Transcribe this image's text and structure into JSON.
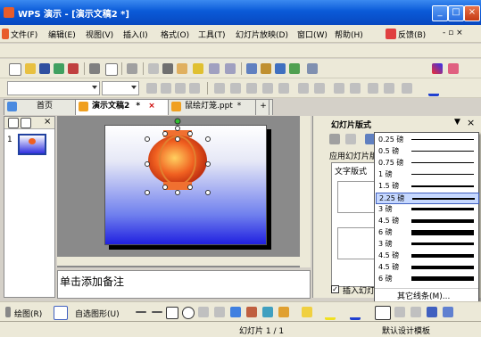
{
  "window": {
    "title": "WPS 演示 - [演示文稿2 *]",
    "min_label": "_",
    "max_label": "□",
    "close_label": "×"
  },
  "menu": {
    "items": [
      "文件(F)",
      "编辑(E)",
      "视图(V)",
      "插入(I)",
      "格式(O)",
      "工具(T)",
      "幻灯片放映(D)",
      "窗口(W)",
      "帮助(H)"
    ],
    "feedback": "反馈(B)",
    "doc_controls": "- ▫ ×"
  },
  "tabs": {
    "home": "首页",
    "doc2": "演示文稿2",
    "doc2_mark": "*",
    "file3": "鼠绘灯笼.ppt",
    "file3_mark": "*",
    "close": "×",
    "new": "+"
  },
  "left_pane": {
    "slide_number": "1"
  },
  "notes": {
    "placeholder": "单击添加备注"
  },
  "task_pane": {
    "title": "幻灯片版式",
    "apply_label": "应用幻灯片版",
    "text_layout_label": "文字版式",
    "insert_label": "插入幻灯"
  },
  "line_dropdown": {
    "items": [
      {
        "label": "0.25 磅",
        "weight": 1
      },
      {
        "label": "0.5 磅",
        "weight": 1
      },
      {
        "label": "0.75 磅",
        "weight": 1
      },
      {
        "label": "1 磅",
        "weight": 1
      },
      {
        "label": "1.5 磅",
        "weight": 2
      },
      {
        "label": "2.25 磅",
        "weight": 2,
        "selected": true
      },
      {
        "label": "3 磅",
        "weight": 3
      },
      {
        "label": "4.5 磅",
        "weight": 4
      },
      {
        "label": "6 磅",
        "weight": 6
      },
      {
        "label": "3 磅",
        "weight": 3
      },
      {
        "label": "4.5 磅",
        "weight": 4
      },
      {
        "label": "4.5 磅",
        "weight": 4
      },
      {
        "label": "6 磅",
        "weight": 5
      }
    ],
    "more_label": "其它线条(M)..."
  },
  "draw_toolbar": {
    "draw_label": "绘图(R)",
    "autoshape_label": "自选图形(U)"
  },
  "statusbar": {
    "slide_info": "幻灯片 1 / 1",
    "template": "默认设计模板"
  },
  "colors": {
    "title_bar": "#0a5ad8",
    "toolbar_bg": "#ece9d8",
    "lantern": "#f06020",
    "selection": "#c6d8ff"
  }
}
